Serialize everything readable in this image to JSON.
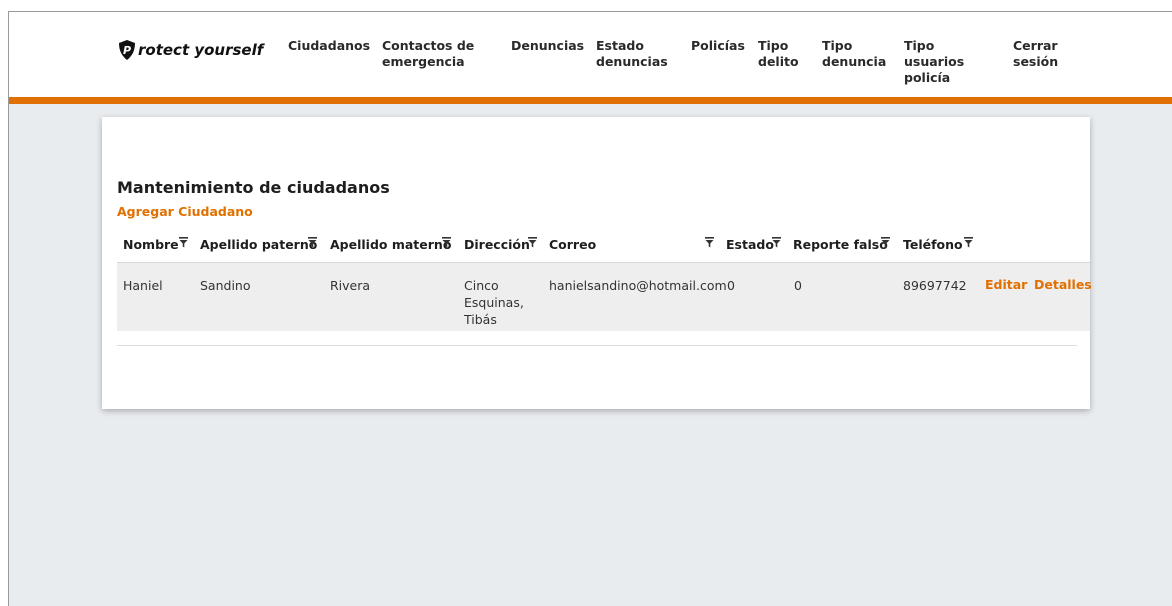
{
  "brand": {
    "name": "rotect yourself",
    "logo_letter": "P"
  },
  "nav": [
    {
      "id": "ciudadanos",
      "label": "Ciudadanos"
    },
    {
      "id": "contactos",
      "label": "Contactos de emergencia"
    },
    {
      "id": "denuncias",
      "label": "Denuncias"
    },
    {
      "id": "estado-denuncias",
      "label": "Estado denuncias"
    },
    {
      "id": "policias",
      "label": "Policías"
    },
    {
      "id": "tipo-delito",
      "label": "Tipo delito"
    },
    {
      "id": "tipo-denuncia",
      "label": "Tipo denuncia"
    },
    {
      "id": "tipo-usuarios-policia",
      "label": "Tipo usuarios policía"
    },
    {
      "id": "cerrar-sesion",
      "label": "Cerrar sesión"
    }
  ],
  "page": {
    "title": "Mantenimiento de ciudadanos",
    "add_label": "Agregar Ciudadano"
  },
  "table": {
    "columns": [
      {
        "key": "nombre",
        "label": "Nombre",
        "filter": true
      },
      {
        "key": "apellido_paterno",
        "label": "Apellido paterno",
        "filter": true
      },
      {
        "key": "apellido_materno",
        "label": "Apellido materno",
        "filter": true
      },
      {
        "key": "direccion",
        "label": "Dirección",
        "filter": true
      },
      {
        "key": "correo",
        "label": "Correo",
        "filter": true
      },
      {
        "key": "estado",
        "label": "Estado",
        "filter": true
      },
      {
        "key": "reporte_falso",
        "label": "Reporte falso",
        "filter": true
      },
      {
        "key": "telefono",
        "label": "Teléfono",
        "filter": true
      }
    ],
    "rows": [
      {
        "nombre": "Haniel",
        "apellido_paterno": "Sandino",
        "apellido_materno": "Rivera",
        "direccion": "Cinco Esquinas, Tibás",
        "correo": "hanielsandino@hotmail.com",
        "estado": "0",
        "reporte_falso": "0",
        "telefono": "89697742",
        "actions": {
          "edit": "Editar",
          "details": "Detalles"
        }
      }
    ]
  },
  "colors": {
    "accent": "#e07000",
    "background": "#e9ecef"
  }
}
